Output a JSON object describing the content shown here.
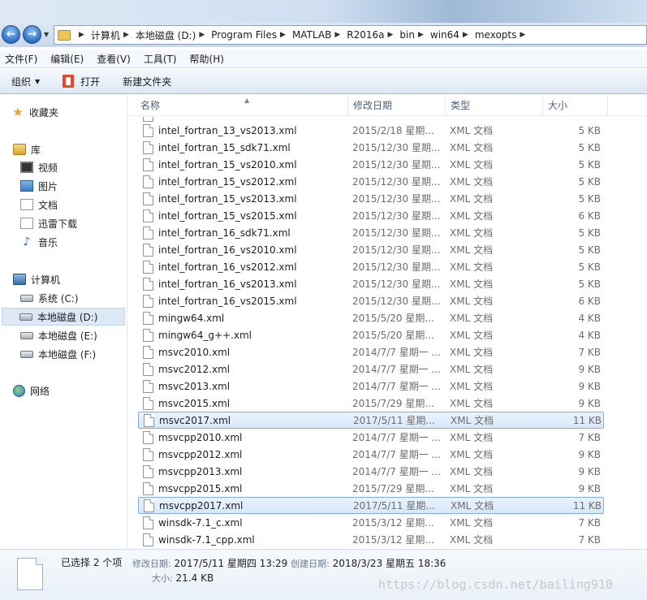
{
  "address": {
    "crumbs": [
      "计算机",
      "本地磁盘 (D:)",
      "Program Files",
      "MATLAB",
      "R2016a",
      "bin",
      "win64",
      "mexopts"
    ]
  },
  "menu": [
    "文件(F)",
    "编辑(E)",
    "查看(V)",
    "工具(T)",
    "帮助(H)"
  ],
  "toolbar": {
    "organize": "组织",
    "open": "打开",
    "new_folder": "新建文件夹"
  },
  "nav": {
    "favorites": "收藏夹",
    "libraries": "库",
    "lib_items": [
      "视频",
      "图片",
      "文档",
      "迅雷下载",
      "音乐"
    ],
    "computer": "计算机",
    "drives": [
      "系统 (C:)",
      "本地磁盘 (D:)",
      "本地磁盘 (E:)",
      "本地磁盘 (F:)"
    ],
    "network": "网络"
  },
  "columns": {
    "name": "名称",
    "date": "修改日期",
    "type": "类型",
    "size": "大小"
  },
  "files": [
    {
      "name": "intel_fortran_13_vs2013.xml",
      "date": "2015/2/18 星期...",
      "type": "XML 文档",
      "size": "5 KB",
      "selected": false
    },
    {
      "name": "intel_fortran_15_sdk71.xml",
      "date": "2015/12/30 星期...",
      "type": "XML 文档",
      "size": "5 KB",
      "selected": false
    },
    {
      "name": "intel_fortran_15_vs2010.xml",
      "date": "2015/12/30 星期...",
      "type": "XML 文档",
      "size": "5 KB",
      "selected": false
    },
    {
      "name": "intel_fortran_15_vs2012.xml",
      "date": "2015/12/30 星期...",
      "type": "XML 文档",
      "size": "5 KB",
      "selected": false
    },
    {
      "name": "intel_fortran_15_vs2013.xml",
      "date": "2015/12/30 星期...",
      "type": "XML 文档",
      "size": "5 KB",
      "selected": false
    },
    {
      "name": "intel_fortran_15_vs2015.xml",
      "date": "2015/12/30 星期...",
      "type": "XML 文档",
      "size": "6 KB",
      "selected": false
    },
    {
      "name": "intel_fortran_16_sdk71.xml",
      "date": "2015/12/30 星期...",
      "type": "XML 文档",
      "size": "5 KB",
      "selected": false
    },
    {
      "name": "intel_fortran_16_vs2010.xml",
      "date": "2015/12/30 星期...",
      "type": "XML 文档",
      "size": "5 KB",
      "selected": false
    },
    {
      "name": "intel_fortran_16_vs2012.xml",
      "date": "2015/12/30 星期...",
      "type": "XML 文档",
      "size": "5 KB",
      "selected": false
    },
    {
      "name": "intel_fortran_16_vs2013.xml",
      "date": "2015/12/30 星期...",
      "type": "XML 文档",
      "size": "5 KB",
      "selected": false
    },
    {
      "name": "intel_fortran_16_vs2015.xml",
      "date": "2015/12/30 星期...",
      "type": "XML 文档",
      "size": "6 KB",
      "selected": false
    },
    {
      "name": "mingw64.xml",
      "date": "2015/5/20 星期...",
      "type": "XML 文档",
      "size": "4 KB",
      "selected": false
    },
    {
      "name": "mingw64_g++.xml",
      "date": "2015/5/20 星期...",
      "type": "XML 文档",
      "size": "4 KB",
      "selected": false
    },
    {
      "name": "msvc2010.xml",
      "date": "2014/7/7 星期一 ...",
      "type": "XML 文档",
      "size": "7 KB",
      "selected": false
    },
    {
      "name": "msvc2012.xml",
      "date": "2014/7/7 星期一 ...",
      "type": "XML 文档",
      "size": "9 KB",
      "selected": false
    },
    {
      "name": "msvc2013.xml",
      "date": "2014/7/7 星期一 ...",
      "type": "XML 文档",
      "size": "9 KB",
      "selected": false
    },
    {
      "name": "msvc2015.xml",
      "date": "2015/7/29 星期...",
      "type": "XML 文档",
      "size": "9 KB",
      "selected": false
    },
    {
      "name": "msvc2017.xml",
      "date": "2017/5/11 星期...",
      "type": "XML 文档",
      "size": "11 KB",
      "selected": true
    },
    {
      "name": "msvcpp2010.xml",
      "date": "2014/7/7 星期一 ...",
      "type": "XML 文档",
      "size": "7 KB",
      "selected": false
    },
    {
      "name": "msvcpp2012.xml",
      "date": "2014/7/7 星期一 ...",
      "type": "XML 文档",
      "size": "9 KB",
      "selected": false
    },
    {
      "name": "msvcpp2013.xml",
      "date": "2014/7/7 星期一 ...",
      "type": "XML 文档",
      "size": "9 KB",
      "selected": false
    },
    {
      "name": "msvcpp2015.xml",
      "date": "2015/7/29 星期...",
      "type": "XML 文档",
      "size": "9 KB",
      "selected": false
    },
    {
      "name": "msvcpp2017.xml",
      "date": "2017/5/11 星期...",
      "type": "XML 文档",
      "size": "11 KB",
      "selected": true
    },
    {
      "name": "winsdk-7.1_c.xml",
      "date": "2015/3/12 星期...",
      "type": "XML 文档",
      "size": "7 KB",
      "selected": false
    },
    {
      "name": "winsdk-7.1_cpp.xml",
      "date": "2015/3/12 星期...",
      "type": "XML 文档",
      "size": "7 KB",
      "selected": false
    }
  ],
  "details": {
    "selection": "已选择 2 个项",
    "modified_label": "修改日期:",
    "modified_value": "2017/5/11 星期四 13:29",
    "created_label": "创建日期:",
    "created_value": "2018/3/23 星期五 18:36",
    "size_label": "大小:",
    "size_value": "21.4 KB"
  },
  "watermark": "https://blog.csdn.net/bailing910"
}
